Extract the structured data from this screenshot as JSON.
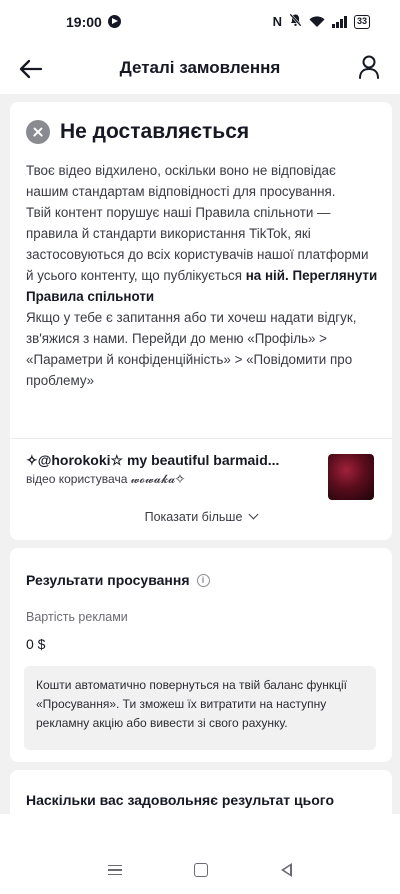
{
  "status_bar": {
    "time": "19:00",
    "nfc_label": "N",
    "battery": "33",
    "icons": [
      "app-notification-icon",
      "nfc-icon",
      "mute-icon",
      "wifi-icon",
      "signal-icon",
      "battery-icon"
    ]
  },
  "header": {
    "title": "Деталі замовлення",
    "back_icon": "arrow-left-icon",
    "profile_icon": "person-icon"
  },
  "status_card": {
    "title": "Не доставляється",
    "icon": "x-circle-icon",
    "paragraph1": "Твоє відео відхилено, оскільки воно не відповідає нашим стандартам відповідності для просування.",
    "paragraph2": "Твій контент порушує наші Правила спільноти — правила й стандарти використання TikTok, які застосовуються до всіх користувачів нашої платформи й усього контенту, що публікується",
    "paragraph2_end": "на ній.",
    "rules_link": "Переглянути Правила спільноти",
    "paragraph3": "Якщо у тебе є запитання або ти хочеш надати відгук, зв'яжися з нами. Перейди до меню «Профіль» > «Параметри й конфіденційність» > «Повідомити про проблему»",
    "video_title": "✧@horokoki☆ my beautiful barmaid...",
    "video_author": "відео користувача 𝔀𝓸𝔀𝓪𝓴𝓪✧",
    "show_more": "Показати більше"
  },
  "results_card": {
    "title": "Результати просування",
    "info_glyph": "i",
    "cost_label": "Вартість реклами",
    "cost_value": "0 $",
    "note": "Кошти автоматично повернуться на твій баланс функції «Просування». Ти зможеш їх витратити на наступну рекламну акцію або вивести зі свого рахунку."
  },
  "satisfaction_card": {
    "title": "Наскільки вас задовольняє результат цього"
  },
  "nav_bar": {
    "icons": [
      "menu-icon",
      "home-icon",
      "back-icon"
    ]
  }
}
